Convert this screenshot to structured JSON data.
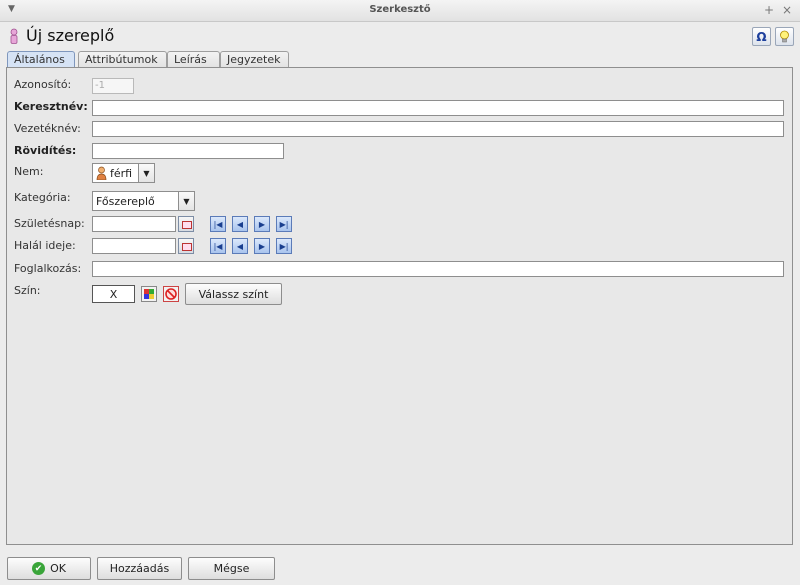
{
  "window": {
    "title": "Szerkesztő",
    "menu_icon": "chevron-down-icon",
    "controls": [
      "+",
      "×"
    ]
  },
  "header": {
    "title": "Új szereplő",
    "icons": [
      "omega-icon",
      "lightbulb-icon"
    ],
    "omega_glyph": "Ω"
  },
  "tabs": [
    {
      "label": "Általános",
      "active": true
    },
    {
      "label": "Attribútumok",
      "active": false
    },
    {
      "label": "Leírás",
      "active": false
    },
    {
      "label": "Jegyzetek",
      "active": false
    }
  ],
  "form": {
    "azonosito": {
      "label": "Azonosító:",
      "value": "-1"
    },
    "keresztnev": {
      "label": "Keresztnév:",
      "value": ""
    },
    "vezeteknev": {
      "label": "Vezetéknév:",
      "value": ""
    },
    "rovidites": {
      "label": "Rövidítés:",
      "value": ""
    },
    "nem": {
      "label": "Nem:",
      "value": "férfi"
    },
    "kategoria": {
      "label": "Kategória:",
      "value": "Főszereplő"
    },
    "szuletesnap": {
      "label": "Születésnap:",
      "value": ""
    },
    "halal_ideje": {
      "label": "Halál ideje:",
      "value": ""
    },
    "foglalkozas": {
      "label": "Foglalkozás:",
      "value": ""
    },
    "szin": {
      "label": "Szín:",
      "value": "X",
      "button": "Válassz színt"
    }
  },
  "footer": {
    "ok": "OK",
    "add": "Hozzáadás",
    "cancel": "Mégse"
  },
  "colors": {
    "accent": "#1d3f9c",
    "nav_button": "#a9c4ee",
    "ok_green": "#3aa53a"
  }
}
